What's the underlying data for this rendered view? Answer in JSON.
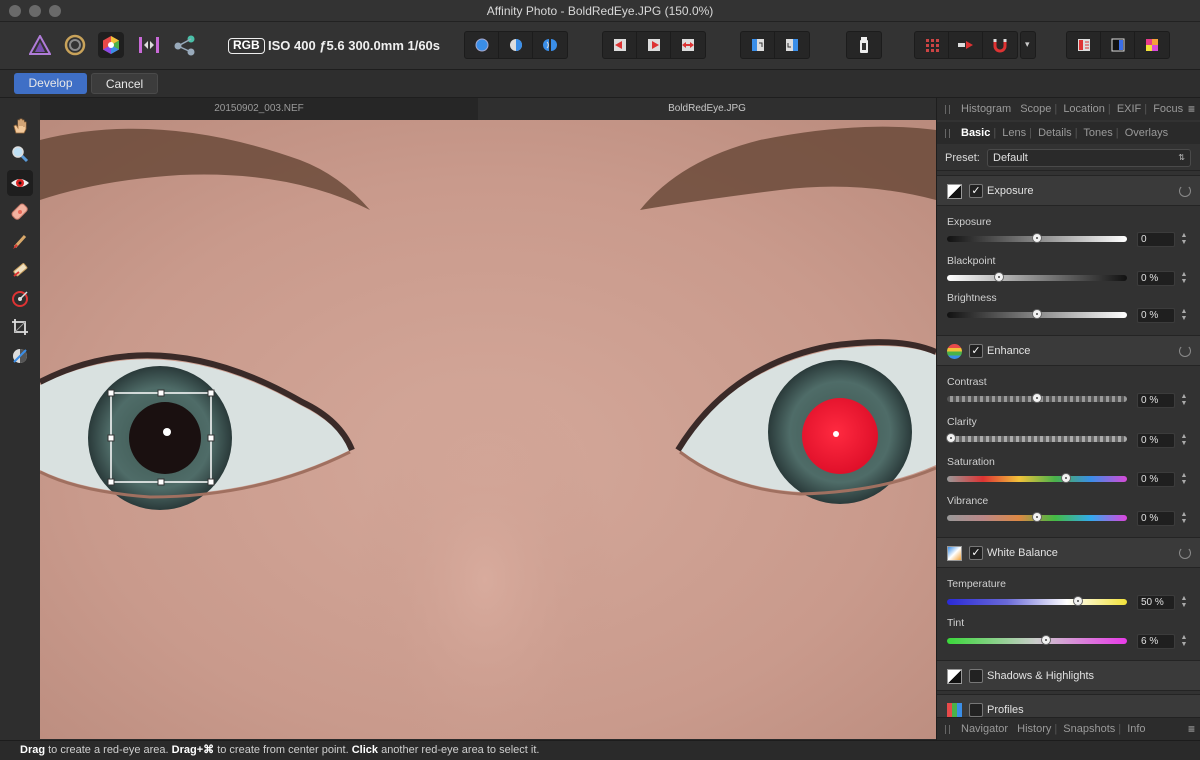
{
  "window": {
    "title": "Affinity Photo - BoldRedEye.JPG (150.0%)"
  },
  "toolbar": {
    "personas": [
      "photo-persona-icon",
      "liquify-persona-icon",
      "develop-persona-icon",
      "tone-mapping-persona-icon",
      "export-persona-icon"
    ],
    "color_mode": "RGB",
    "exif_summary": "ISO 400 ƒ5.6 300.0mm 1/60s",
    "more_chevron": "▾"
  },
  "context": {
    "develop_label": "Develop",
    "cancel_label": "Cancel"
  },
  "documents": {
    "tabs": [
      "20150902_003.NEF",
      "BoldRedEye.JPG"
    ]
  },
  "panel_top": {
    "tabs": [
      "Histogram",
      "Scope",
      "Location",
      "EXIF",
      "Focus"
    ],
    "subtabs": [
      "Basic",
      "Lens",
      "Details",
      "Tones",
      "Overlays"
    ],
    "preset_label": "Preset:",
    "preset_value": "Default"
  },
  "sections": {
    "exposure": {
      "title": "Exposure",
      "enabled": true
    },
    "enhance": {
      "title": "Enhance",
      "enabled": true
    },
    "white_balance": {
      "title": "White Balance",
      "enabled": true
    },
    "shadows_highlights": {
      "title": "Shadows & Highlights",
      "enabled": false
    },
    "profiles": {
      "title": "Profiles",
      "enabled": false
    }
  },
  "sliders": {
    "exposure": {
      "label": "Exposure",
      "value": "0",
      "level": 0.5
    },
    "blackpoint": {
      "label": "Blackpoint",
      "value": "0 %",
      "level": 0.29
    },
    "brightness": {
      "label": "Brightness",
      "value": "0 %",
      "level": 0.5
    },
    "contrast": {
      "label": "Contrast",
      "value": "0 %",
      "level": 0.5
    },
    "clarity": {
      "label": "Clarity",
      "value": "0 %",
      "level": 0.02
    },
    "saturation": {
      "label": "Saturation",
      "value": "0 %",
      "level": 0.66
    },
    "vibrance": {
      "label": "Vibrance",
      "value": "0 %",
      "level": 0.5
    },
    "temperature": {
      "label": "Temperature",
      "value": "50 %",
      "level": 0.73
    },
    "tint": {
      "label": "Tint",
      "value": "6 %",
      "level": 0.55
    }
  },
  "panel_bottom": {
    "tabs": [
      "Navigator",
      "History",
      "Snapshots",
      "Info"
    ]
  },
  "status": {
    "p1_b": "Drag",
    "p1": " to create a red-eye area. ",
    "p2_b": "Drag+⌘",
    "p2": " to create from center point. ",
    "p3_b": "Click",
    "p3": " another red-eye area to select it."
  },
  "colors": {
    "accent": "#3f6fc6",
    "redeye": "#e8132d"
  }
}
